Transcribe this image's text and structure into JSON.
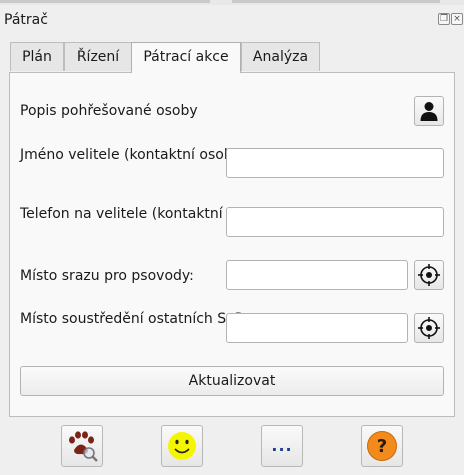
{
  "window": {
    "title": "Pátrač",
    "float_icon": "float-icon",
    "close_icon": "close-icon"
  },
  "tabs": [
    {
      "label": "Plán",
      "active": false
    },
    {
      "label": "Řízení",
      "active": false
    },
    {
      "label": "Pátrací akce",
      "active": true
    },
    {
      "label": "Analýza",
      "active": false
    }
  ],
  "form": {
    "missing_person_label": "Popis pohřešované osoby",
    "commander_name_label": "Jméno velitele (kontaktní osoby):",
    "commander_name_value": "",
    "commander_phone_label": "Telefon na velitele (kontaktní os.):",
    "commander_phone_value": "",
    "dog_meeting_label": "Místo srazu pro psovody:",
    "dog_meeting_value": "",
    "others_gathering_label": "Místo soustředění ostatních SaP:",
    "others_gathering_value": "",
    "update_button": "Aktualizovat"
  },
  "toolbar": {
    "icons": [
      "paw-search-icon",
      "smiley-icon",
      "more-icon",
      "help-icon"
    ],
    "more_label": "...",
    "help_label": "?"
  },
  "colors": {
    "smiley": "#f5f500",
    "help": "#f28a1c",
    "paw": "#7a2418",
    "more": "#1c3f8c"
  }
}
